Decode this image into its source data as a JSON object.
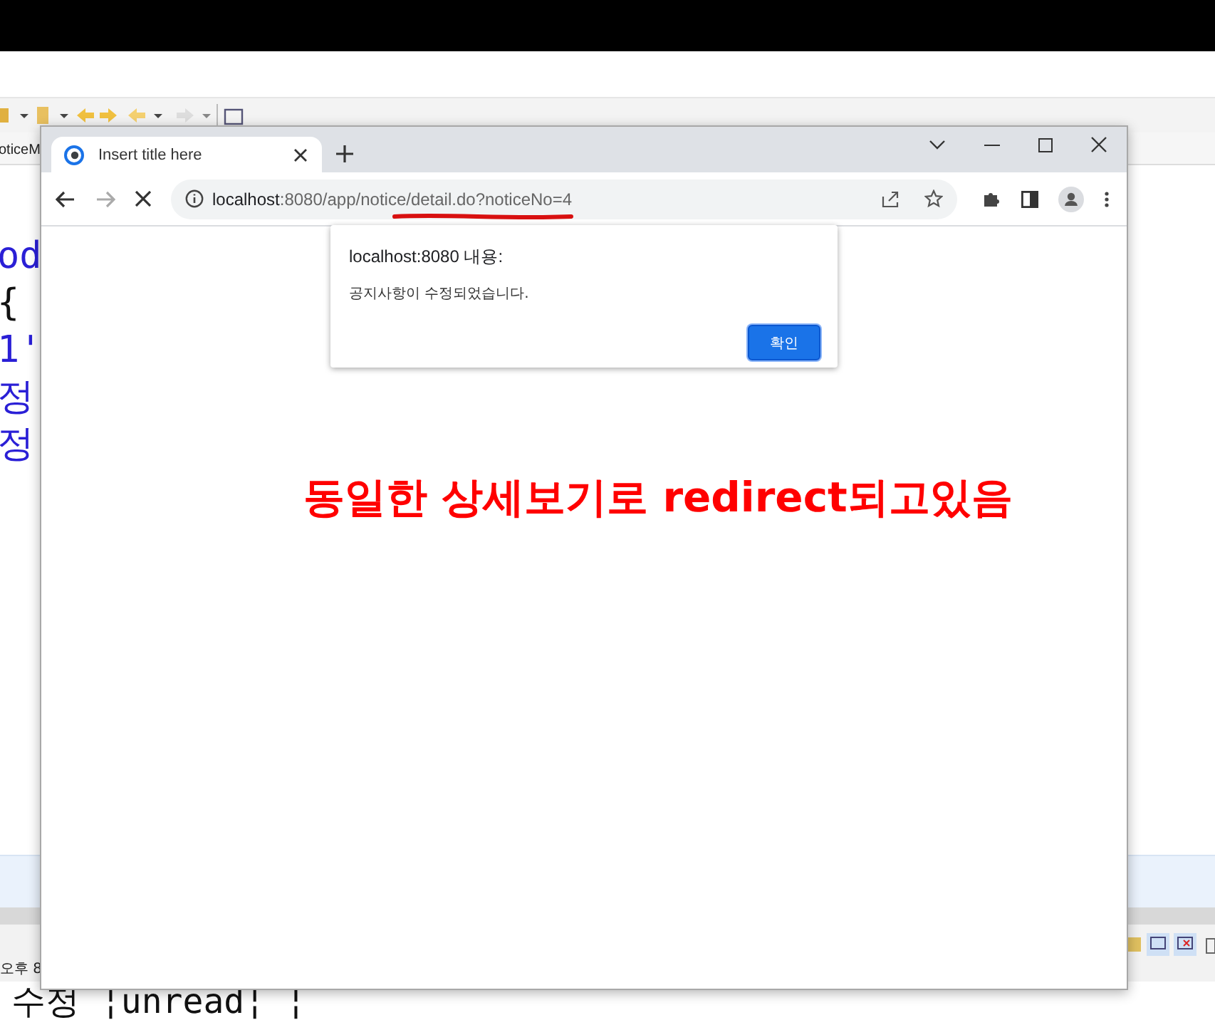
{
  "ide": {
    "tab_label": "oticeM",
    "code_lines": [
      {
        "text": "od",
        "kind": "blue"
      },
      {
        "text": "{",
        "kind": "black"
      },
      {
        "text": "1'",
        "kind": "blue"
      },
      {
        "text": "정",
        "kind": "blue"
      },
      {
        "text": "정",
        "kind": "blue"
      }
    ],
    "status_text": "오후 8",
    "console_line": "수정 ¦unread¦ ¦"
  },
  "browser": {
    "tab": {
      "title": "Insert title here",
      "selected": true
    },
    "url": {
      "host": "localhost",
      "rest": ":8080/app/notice/detail.do?noticeNo=4"
    },
    "loading": true
  },
  "dialog": {
    "title": "localhost:8080 내용:",
    "message": "공지사항이 수정되었습니다.",
    "button": "확인"
  },
  "annotation": "동일한 상세보기로 redirect되고있음"
}
